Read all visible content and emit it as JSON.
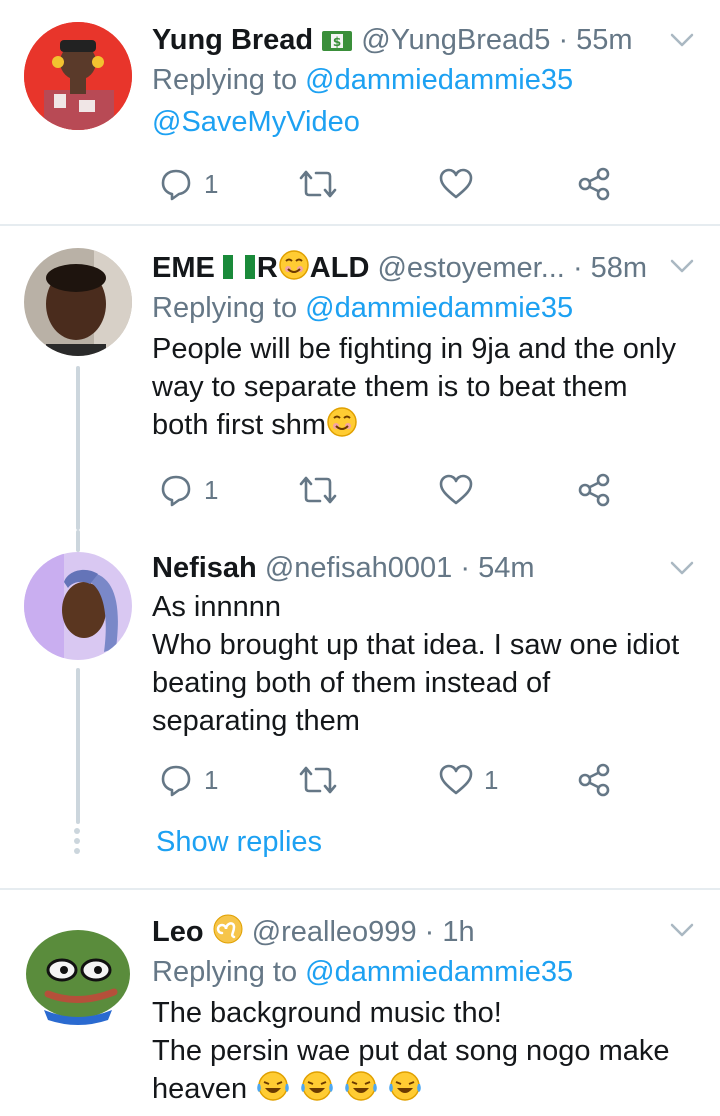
{
  "tweets": [
    {
      "name": "Yung Bread",
      "badge_icon": "money-bill-icon",
      "handle": "@YungBread5",
      "time": "55m",
      "replying_prefix": "Replying to",
      "replying_to": "@dammiedammie35",
      "body": "@SaveMyVideo",
      "reply_count": "1",
      "like_count": ""
    },
    {
      "name_part1": "EME",
      "name_part2": "R",
      "name_part3": "ALD",
      "handle": "@estoyemer...",
      "time": "58m",
      "replying_prefix": "Replying to",
      "replying_to": "@dammiedammie35",
      "body_lines": [
        "People will be fighting in 9ja and the only",
        "way to separate them is to beat them",
        "both first shm"
      ],
      "reply_count": "1",
      "like_count": ""
    },
    {
      "name": "Nefisah",
      "handle": "@nefisah0001",
      "time": "54m",
      "body_lines": [
        "As innnnn",
        "Who brought up that idea. I saw one idiot",
        "beating both of them instead of",
        "separating them"
      ],
      "reply_count": "1",
      "like_count": "1"
    },
    {
      "name": "Leo",
      "handle": "@realleo999",
      "time": "1h",
      "replying_prefix": "Replying to",
      "replying_to": "@dammiedammie35",
      "body_lines": [
        "The background music tho!",
        "The persin wae put dat song nogo make",
        "heaven"
      ]
    }
  ],
  "header_separator": "·",
  "show_replies": "Show replies",
  "colors": {
    "accent": "#1da1f2",
    "muted": "#657786",
    "text": "#14171a",
    "divider": "#e6ecf0"
  }
}
